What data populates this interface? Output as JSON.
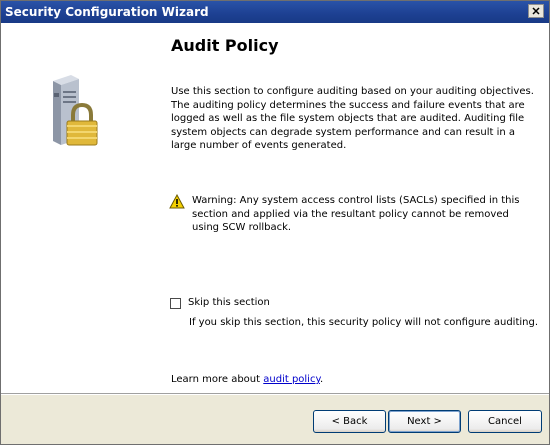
{
  "window": {
    "title": "Security Configuration Wizard"
  },
  "page": {
    "heading": "Audit Policy",
    "description": "Use this section to configure auditing based on your auditing objectives. The auditing policy determines the success and failure events that are logged as well as the file system objects that are audited. Auditing file system objects can degrade system performance and can result in a large number of events generated.",
    "warning": "Warning: Any system access control lists (SACLs) specified in this section and applied via the resultant policy cannot be removed using SCW rollback.",
    "skip_label": "Skip this section",
    "skip_checked": false,
    "skip_note": "If you skip this section, this security policy will not configure auditing.",
    "learn_prefix": "Learn more about ",
    "learn_link": "audit policy",
    "learn_suffix": "."
  },
  "buttons": {
    "back": "< Back",
    "next": "Next >",
    "cancel": "Cancel"
  },
  "icons": {
    "close": "close-icon",
    "server_lock": "server-lock-icon",
    "warning": "warning-icon"
  },
  "colors": {
    "titlebar": "#1d4092",
    "footer": "#ece9d8",
    "link": "#0000cc",
    "warning": "#f5d000"
  }
}
